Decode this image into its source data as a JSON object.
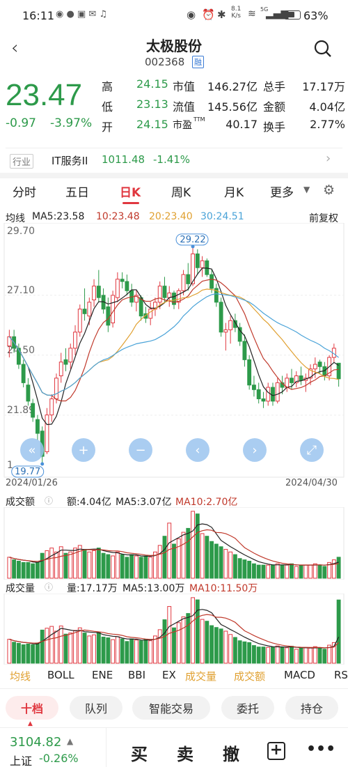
{
  "status": {
    "time": "16:11",
    "speed_top": "8.1",
    "speed_bottom": "K/s",
    "network": "5G",
    "battery": "63%"
  },
  "header": {
    "name": "太极股份",
    "code": "002368",
    "tag": "融"
  },
  "quote": {
    "price": "23.47",
    "change": "-0.97",
    "pct": "-3.97%",
    "rows": [
      {
        "l1": "高",
        "v1": "24.15",
        "l2": "市值",
        "v2": "146.27亿",
        "l3": "总手",
        "v3": "17.17万"
      },
      {
        "l1": "低",
        "v1": "23.13",
        "l2": "流值",
        "v2": "145.56亿",
        "l3": "金额",
        "v3": "4.04亿"
      },
      {
        "l1": "开",
        "v1": "24.15",
        "l2": "市盈",
        "l2sup": "TTM",
        "v2": "40.17",
        "l3": "换手",
        "v3": "2.77%"
      }
    ]
  },
  "industry": {
    "tag": "行业",
    "name": "IT服务II",
    "value": "1011.48",
    "pct": "-1.41%"
  },
  "period_tabs": [
    "分时",
    "五日",
    "日K",
    "周K",
    "月K",
    "更多"
  ],
  "active_tab": "日K",
  "ma": {
    "title": "均线",
    "ma5": "MA5:23.58",
    "ma10": "10:23.48",
    "ma20": "20:23.40",
    "ma30": "30:24.51",
    "adjust": "前复权"
  },
  "price_axis": [
    "29.70",
    "27.10",
    "24.50",
    "21.89",
    "19.77"
  ],
  "price_axis_visible": [
    "29.70",
    "27.10",
    "24.50",
    "21.89",
    "1"
  ],
  "hi_label": "29.22",
  "lo_label": "19.77",
  "dates": {
    "start": "2024/01/26",
    "end": "2024/04/30"
  },
  "amount": {
    "title": "成交额",
    "amt": "额:4.04亿",
    "ma5": "MA5:3.07亿",
    "ma10": "MA10:2.70亿"
  },
  "volume": {
    "title": "成交量",
    "vol": "量:17.17万",
    "ma5": "MA5:13.00万",
    "ma10": "MA10:11.50万"
  },
  "indicators": [
    "均线",
    "BOLL",
    "ENE",
    "BBI",
    "EX",
    "成交量",
    "成交额",
    "MACD",
    "RS"
  ],
  "actions": [
    "十档",
    "队列",
    "智能交易",
    "委托",
    "持仓"
  ],
  "index": {
    "value": "3104.82",
    "name": "上证",
    "pct": "-0.26%"
  },
  "trade": {
    "buy": "买",
    "sell": "卖",
    "cancel": "撤"
  },
  "colors": {
    "up": "#e0373f",
    "down": "#2d9a4a",
    "accent": "#e0373f",
    "ma5": "#222222",
    "ma10": "#c0392b",
    "ma20": "#e0a030",
    "ma30": "#4aa3d8"
  },
  "chart_data": {
    "type": "candlestick",
    "x_range": [
      "2024/01/26",
      "2024/04/30"
    ],
    "ylim": [
      19.77,
      29.7
    ],
    "candles": [
      [
        24.9,
        25.6,
        24.4,
        25.3
      ],
      [
        25.3,
        25.6,
        24.6,
        24.8
      ],
      [
        24.8,
        25.0,
        23.9,
        24.1
      ],
      [
        24.1,
        24.3,
        23.1,
        23.3
      ],
      [
        23.2,
        23.5,
        22.3,
        22.5
      ],
      [
        22.4,
        22.6,
        21.6,
        21.8
      ],
      [
        21.7,
        21.9,
        20.8,
        21.1
      ],
      [
        21.2,
        21.4,
        19.77,
        20.1
      ],
      [
        20.3,
        22.2,
        20.2,
        21.9
      ],
      [
        21.9,
        22.8,
        21.6,
        22.6
      ],
      [
        22.6,
        23.7,
        22.4,
        23.5
      ],
      [
        23.6,
        24.6,
        23.3,
        24.2
      ],
      [
        24.3,
        24.8,
        23.8,
        24.1
      ],
      [
        24.2,
        25.0,
        23.9,
        24.8
      ],
      [
        24.8,
        25.8,
        24.5,
        25.5
      ],
      [
        25.5,
        26.7,
        25.3,
        26.5
      ],
      [
        26.5,
        27.4,
        26.0,
        26.3
      ],
      [
        26.2,
        27.0,
        25.8,
        26.8
      ],
      [
        26.9,
        27.8,
        26.6,
        27.5
      ],
      [
        27.5,
        28.2,
        26.8,
        27.0
      ],
      [
        27.1,
        27.4,
        26.3,
        26.5
      ],
      [
        26.6,
        27.0,
        25.5,
        25.8
      ],
      [
        25.9,
        27.3,
        25.7,
        27.1
      ],
      [
        27.0,
        28.1,
        26.8,
        27.8
      ],
      [
        27.8,
        28.1,
        27.4,
        27.7
      ],
      [
        27.7,
        28.0,
        27.1,
        27.3
      ],
      [
        27.3,
        27.6,
        26.6,
        26.8
      ],
      [
        26.8,
        27.3,
        26.4,
        27.1
      ],
      [
        27.0,
        27.1,
        26.0,
        26.2
      ],
      [
        26.3,
        26.6,
        25.9,
        26.1
      ],
      [
        26.1,
        26.8,
        25.8,
        26.5
      ],
      [
        26.5,
        27.0,
        26.2,
        26.8
      ],
      [
        26.8,
        27.7,
        26.5,
        27.5
      ],
      [
        27.5,
        27.9,
        26.8,
        27.0
      ],
      [
        27.0,
        27.5,
        26.6,
        27.2
      ],
      [
        27.2,
        27.3,
        26.5,
        26.7
      ],
      [
        26.8,
        27.4,
        26.5,
        27.3
      ],
      [
        27.3,
        28.2,
        27.1,
        28.0
      ],
      [
        28.0,
        28.5,
        27.3,
        27.6
      ],
      [
        27.6,
        29.22,
        27.5,
        28.9
      ],
      [
        28.9,
        29.1,
        28.0,
        28.3
      ],
      [
        28.3,
        28.8,
        27.9,
        28.6
      ],
      [
        28.6,
        28.7,
        27.9,
        28.0
      ],
      [
        28.0,
        28.2,
        27.2,
        27.4
      ],
      [
        27.4,
        27.6,
        26.6,
        26.8
      ],
      [
        26.8,
        27.0,
        25.3,
        25.5
      ],
      [
        25.5,
        25.9,
        24.7,
        25.6
      ],
      [
        25.6,
        26.2,
        25.0,
        26.0
      ],
      [
        26.0,
        26.3,
        25.5,
        25.7
      ],
      [
        25.7,
        25.9,
        24.9,
        25.1
      ],
      [
        25.1,
        25.4,
        24.0,
        24.3
      ],
      [
        24.3,
        24.5,
        23.0,
        23.2
      ],
      [
        23.2,
        23.6,
        22.7,
        23.0
      ],
      [
        23.0,
        23.3,
        22.4,
        22.6
      ],
      [
        22.6,
        22.9,
        22.2,
        22.5
      ],
      [
        22.5,
        23.3,
        22.3,
        23.1
      ],
      [
        23.1,
        23.3,
        22.3,
        22.5
      ],
      [
        22.5,
        23.5,
        22.4,
        23.3
      ],
      [
        23.3,
        23.6,
        22.8,
        23.1
      ],
      [
        23.1,
        23.7,
        22.9,
        23.5
      ],
      [
        23.5,
        23.9,
        23.0,
        23.3
      ],
      [
        23.3,
        23.8,
        23.1,
        23.6
      ],
      [
        23.6,
        24.0,
        23.2,
        23.4
      ],
      [
        23.4,
        23.7,
        22.9,
        23.5
      ],
      [
        23.5,
        24.1,
        23.2,
        23.9
      ],
      [
        23.9,
        24.4,
        23.5,
        24.1
      ],
      [
        24.2,
        24.3,
        23.7,
        24.0
      ],
      [
        24.0,
        24.2,
        23.4,
        23.6
      ],
      [
        23.6,
        24.5,
        23.4,
        24.4
      ],
      [
        24.4,
        25.0,
        24.2,
        24.8
      ],
      [
        24.15,
        24.15,
        23.13,
        23.47
      ]
    ],
    "amount": [
      1.6,
      1.4,
      1.3,
      1.2,
      1.2,
      1.1,
      1.2,
      1.9,
      2.1,
      2.3,
      2.0,
      2.4,
      1.9,
      2.0,
      2.3,
      2.5,
      2.2,
      2.0,
      2.1,
      2.3,
      1.9,
      1.8,
      1.7,
      2.0,
      1.8,
      1.6,
      1.8,
      1.7,
      1.6,
      1.7,
      1.6,
      2.0,
      2.5,
      3.2,
      4.2,
      2.6,
      3.0,
      3.5,
      3.8,
      5.1,
      4.9,
      3.4,
      3.2,
      2.8,
      2.6,
      2.4,
      2.2,
      2.0,
      1.8,
      1.5,
      1.4,
      1.3,
      1.1,
      1.0,
      1.0,
      1.0,
      1.0,
      1.1,
      1.0,
      1.0,
      1.1,
      0.9,
      1.0,
      1.0,
      1.0,
      1.1,
      1.0,
      0.9,
      1.2,
      1.4,
      1.6
    ],
    "volume": [
      6.5,
      5.7,
      5.4,
      5.0,
      5.2,
      5.0,
      5.5,
      9.0,
      9.5,
      10.0,
      8.7,
      10.1,
      7.9,
      8.2,
      8.9,
      9.6,
      8.2,
      7.4,
      7.7,
      8.4,
      7.1,
      6.9,
      6.4,
      7.2,
      6.6,
      5.9,
      6.6,
      6.3,
      6.1,
      6.5,
      6.1,
      7.4,
      9.1,
      11.8,
      15.4,
      9.6,
      11.0,
      12.6,
      13.5,
      17.8,
      17.2,
      11.9,
      11.4,
      10.2,
      9.7,
      9.3,
      8.7,
      7.8,
      7.0,
      6.1,
      5.8,
      5.6,
      4.8,
      4.4,
      4.4,
      4.3,
      4.4,
      4.7,
      4.3,
      4.2,
      4.6,
      3.8,
      4.2,
      4.2,
      4.1,
      4.5,
      4.1,
      3.8,
      4.9,
      5.6,
      17.17
    ]
  }
}
